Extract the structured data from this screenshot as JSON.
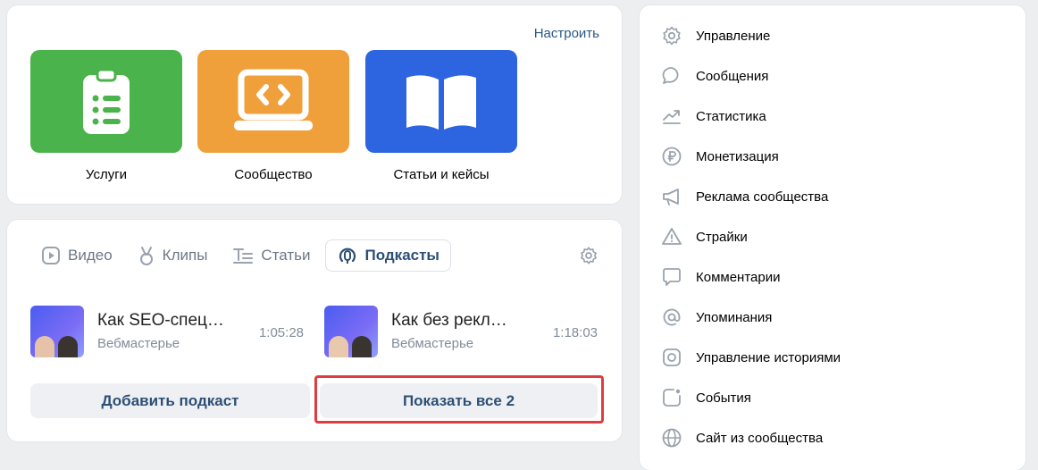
{
  "apps": {
    "configure_label": "Настроить",
    "items": [
      {
        "label": "Услуги",
        "color": "#4bb34b",
        "icon": "clipboard-list-icon"
      },
      {
        "label": "Сообщество",
        "color": "#f0a03a",
        "icon": "laptop-code-icon"
      },
      {
        "label": "Статьи и кейсы",
        "color": "#2d64e0",
        "icon": "book-open-icon"
      }
    ]
  },
  "media": {
    "tabs": [
      {
        "label": "Видео",
        "icon": "video-icon",
        "active": false
      },
      {
        "label": "Клипы",
        "icon": "clips-icon",
        "active": false
      },
      {
        "label": "Статьи",
        "icon": "articles-icon",
        "active": false
      },
      {
        "label": "Подкасты",
        "icon": "podcast-icon",
        "active": true
      }
    ],
    "podcasts": [
      {
        "title": "Как SEO-спец…",
        "author": "Вебмастерье",
        "duration": "1:05:28"
      },
      {
        "title": "Как без рекл…",
        "author": "Вебмастерье",
        "duration": "1:18:03"
      }
    ],
    "add_label": "Добавить подкаст",
    "show_all_label": "Показать все 2"
  },
  "menu": {
    "items": [
      {
        "label": "Управление",
        "icon": "gear-icon"
      },
      {
        "label": "Сообщения",
        "icon": "message-icon"
      },
      {
        "label": "Статистика",
        "icon": "stats-icon"
      },
      {
        "label": "Монетизация",
        "icon": "ruble-icon"
      },
      {
        "label": "Реклама сообщества",
        "icon": "megaphone-icon"
      },
      {
        "label": "Страйки",
        "icon": "warning-icon"
      },
      {
        "label": "Комментарии",
        "icon": "comment-icon"
      },
      {
        "label": "Упоминания",
        "icon": "at-icon"
      },
      {
        "label": "Управление историями",
        "icon": "stories-icon"
      },
      {
        "label": "События",
        "icon": "events-icon"
      },
      {
        "label": "Сайт из сообщества",
        "icon": "globe-icon"
      }
    ]
  }
}
